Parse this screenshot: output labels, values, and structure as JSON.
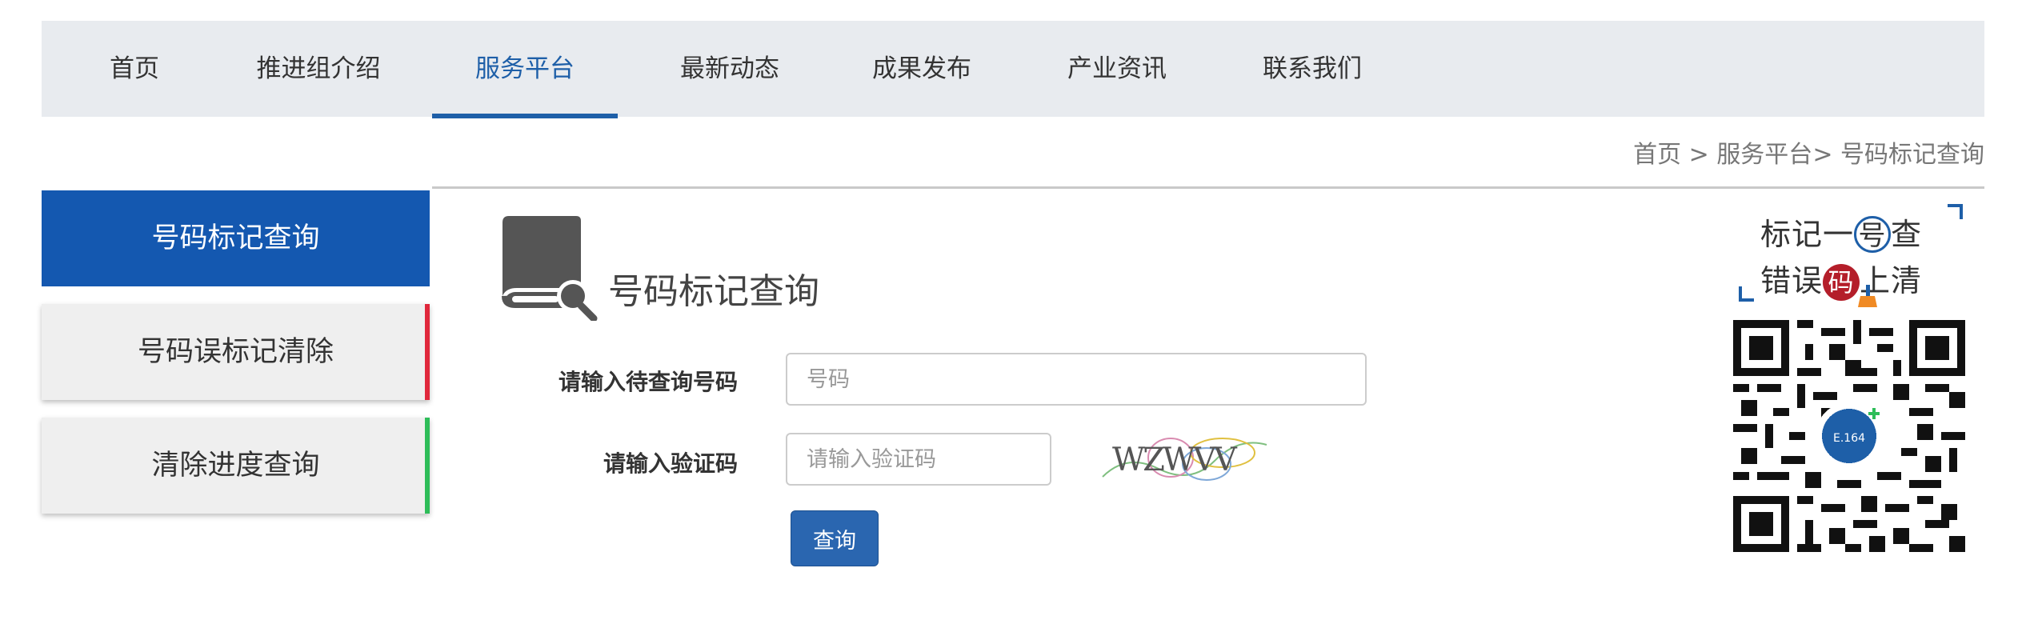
{
  "nav": {
    "items": [
      {
        "label": "首页"
      },
      {
        "label": "推进组介绍"
      },
      {
        "label": "服务平台"
      },
      {
        "label": "最新动态"
      },
      {
        "label": "成果发布"
      },
      {
        "label": "产业资讯"
      },
      {
        "label": "联系我们"
      }
    ],
    "active_index": 2,
    "active_color": "#1e5fa8"
  },
  "breadcrumb": {
    "home": "首页",
    "sep1": " > ",
    "section": "服务平台",
    "sep2": "> ",
    "current": "号码标记查询"
  },
  "sidebar": {
    "items": [
      {
        "label": "号码标记查询",
        "accent": "#1458b0"
      },
      {
        "label": "号码误标记清除",
        "accent": "#e0283c"
      },
      {
        "label": "清除进度查询",
        "accent": "#2ebd59"
      }
    ],
    "active_index": 0
  },
  "main": {
    "title": "号码标记查询",
    "icon": "book-search-icon",
    "form": {
      "phone_label": "请输入待查询号码",
      "phone_placeholder": "号码",
      "phone_value": "",
      "captcha_label": "请输入验证码",
      "captcha_placeholder": "请输入验证码",
      "captcha_value": "",
      "captcha_text": "WZWVV",
      "submit_label": "查询"
    }
  },
  "promo": {
    "line1_a": "标记一",
    "line1_b": "号",
    "line1_c": "查",
    "line2_a": "错误",
    "line2_b": "码",
    "line2_c": "上清",
    "qr_badge": "E.164",
    "icon": "qr-code-icon"
  }
}
